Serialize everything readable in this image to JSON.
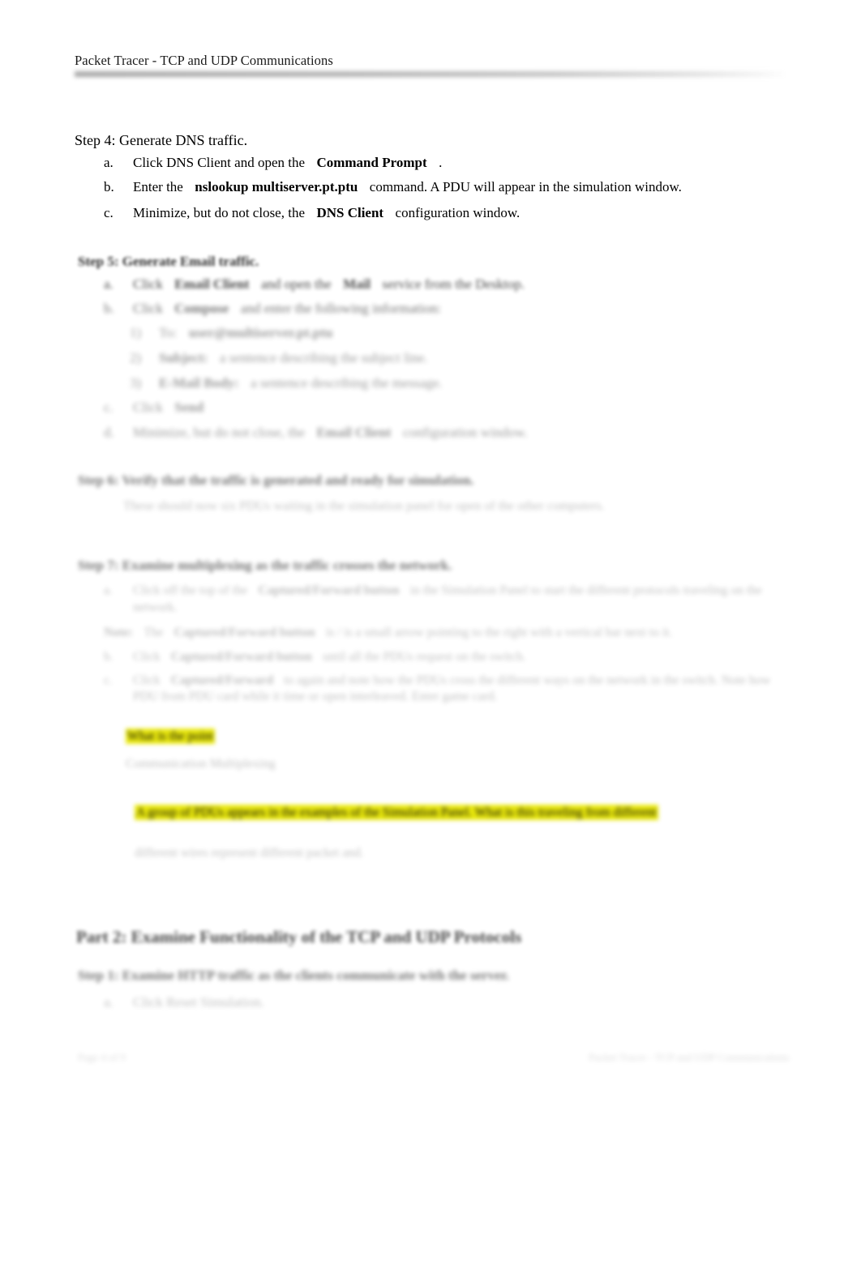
{
  "document": {
    "header_title": "Packet Tracer - TCP and UDP Communications"
  },
  "step4": {
    "heading": "Step 4: Generate DNS traffic.",
    "items": [
      {
        "marker": "a.",
        "parts": [
          {
            "text": "Click DNS Client and open the",
            "bold": false
          },
          {
            "text": "Command Prompt",
            "bold": true
          },
          {
            "text": ".",
            "bold": false
          }
        ]
      },
      {
        "marker": "b.",
        "parts": [
          {
            "text": "Enter the",
            "bold": false
          },
          {
            "text": "nslookup multiserver.pt.ptu",
            "bold": true
          },
          {
            "text": "command. A PDU will appear in the simulation window.",
            "bold": false
          }
        ]
      },
      {
        "marker": "c.",
        "parts": [
          {
            "text": "Minimize, but do not close, the",
            "bold": false
          },
          {
            "text": "DNS Client",
            "bold": true
          },
          {
            "text": "configuration window.",
            "bold": false
          }
        ]
      }
    ]
  },
  "step5": {
    "heading": "Step 5: Generate Email traffic.",
    "items": [
      {
        "marker": "a.",
        "parts": [
          {
            "text": "Click",
            "bold": false
          },
          {
            "text": "Email Client",
            "bold": true
          },
          {
            "text": "and open the",
            "bold": false
          },
          {
            "text": "Mail",
            "bold": true
          },
          {
            "text": "service from the Desktop.",
            "bold": false
          }
        ]
      },
      {
        "marker": "b.",
        "parts": [
          {
            "text": "Click",
            "bold": false
          },
          {
            "text": "Compose",
            "bold": true
          },
          {
            "text": "and enter the following information:",
            "bold": false
          }
        ]
      },
      {
        "marker": "c.",
        "parts": [
          {
            "text": "Click",
            "bold": false
          },
          {
            "text": "Send",
            "bold": true
          }
        ]
      },
      {
        "marker": "d.",
        "parts": [
          {
            "text": "Minimize, but do not close, the",
            "bold": false
          },
          {
            "text": "Email Client",
            "bold": true
          },
          {
            "text": "configuration window.",
            "bold": false
          }
        ]
      }
    ],
    "subitems": [
      {
        "marker": "1)",
        "parts": [
          {
            "text": "To:",
            "bold": false
          },
          {
            "text": "user@multiserver.pt.ptu",
            "bold": true
          }
        ]
      },
      {
        "marker": "2)",
        "parts": [
          {
            "text": "Subject:",
            "bold": true
          },
          {
            "text": "a sentence describing the subject line.",
            "bold": false
          }
        ]
      },
      {
        "marker": "3)",
        "parts": [
          {
            "text": "E-Mail Body:",
            "bold": true
          },
          {
            "text": "a sentence describing the message.",
            "bold": false
          }
        ]
      }
    ]
  },
  "step6": {
    "heading": "Step 6: Verify that the traffic is generated and ready for simulation.",
    "body": "These should now six PDUs waiting in the simulation panel for open of the other computers."
  },
  "step7": {
    "heading": "Step 7: Examine multiplexing as the traffic crosses the network.",
    "items": [
      {
        "marker": "a.",
        "parts": [
          {
            "text": "Click off the top of the",
            "bold": false
          },
          {
            "text": "Captured/Forward button",
            "bold": true
          },
          {
            "text": "in the Simulation Panel to start the different protocols traveling on the network.",
            "bold": false
          }
        ]
      },
      {
        "marker": "b.",
        "parts": [
          {
            "text": "Click",
            "bold": false
          },
          {
            "text": "Captured/Forward button",
            "bold": true
          },
          {
            "text": "until all the PDUs request on the switch.",
            "bold": false
          }
        ]
      },
      {
        "marker": "c.",
        "parts": [
          {
            "text": "Click",
            "bold": false
          },
          {
            "text": "Captured/Forward",
            "bold": true
          },
          {
            "text": "to again and note how the PDUs cross the different ways on the network in the switch. Note how PDU from PDU card while it time or open interleaved. Enter game card.",
            "bold": false
          }
        ]
      }
    ],
    "note": {
      "label": "Note:",
      "parts": [
        {
          "text": "The",
          "bold": false
        },
        {
          "text": "Captured/Forward button",
          "bold": true
        },
        {
          "text": "is / is a small arrow pointing to the right with a vertical bar next to it.",
          "bold": false
        }
      ]
    },
    "question1": {
      "highlight": "What is the point",
      "answer": "Communication Multiplexing"
    },
    "question2": {
      "highlight": "A group of PDUs appears in the examples of the Simulation Panel. What is this traveling from different",
      "answer": "different wires represent different packet and."
    }
  },
  "part2": {
    "heading": "Part 2: Examine Functionality of the TCP and UDP Protocols",
    "step_heading": "Step 1: Examine HTTP traffic as the clients communicate with the server.",
    "items": [
      {
        "marker": "a.",
        "parts": [
          {
            "text": "Click Reset Simulation.",
            "bold": false
          }
        ]
      }
    ]
  },
  "footer": {
    "left": "Page 4 of 9",
    "right": "Packet Tracer - TCP and UDP Communications"
  }
}
